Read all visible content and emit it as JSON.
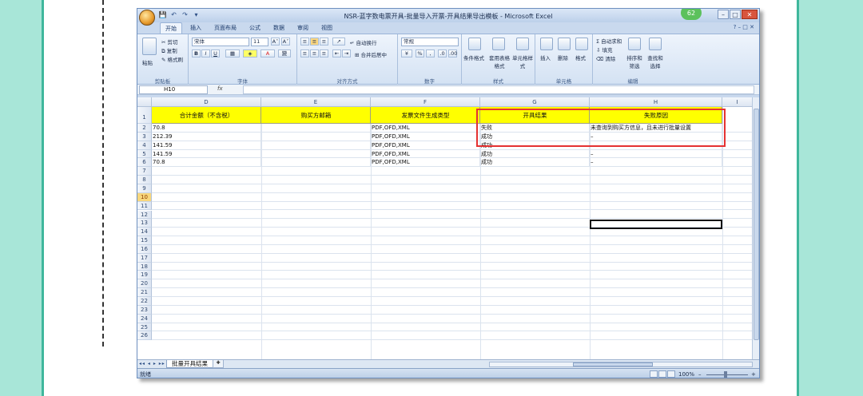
{
  "window": {
    "title": "NSR-蓝字数电票开具-批量导入开票-开具结果导出模板 - Microsoft Excel",
    "badge": "62",
    "controls": [
      "–",
      "□",
      "✕"
    ]
  },
  "qat": [
    "💾",
    "↶",
    "↷",
    "▾"
  ],
  "tabs": [
    "开始",
    "插入",
    "页面布局",
    "公式",
    "数据",
    "审阅",
    "视图"
  ],
  "active_tab": "开始",
  "ribbon": {
    "clipboard": {
      "paste": "粘贴",
      "cut": "剪切",
      "copy": "复制",
      "format_painter": "格式刷",
      "label": "剪贴板"
    },
    "font": {
      "name": "宋体",
      "size": "11",
      "bold": "B",
      "italic": "I",
      "underline": "U",
      "grow": "A˄",
      "shrink": "A˅",
      "wen": "變",
      "label": "字体"
    },
    "alignment": {
      "wrap": "自动换行",
      "merge": "合并后居中",
      "label": "对齐方式"
    },
    "number": {
      "format": "常规",
      "percent": "%",
      "comma": ",",
      "label": "数字"
    },
    "styles": {
      "conditional": "条件格式",
      "table": "套用表格格式",
      "cell": "单元格样式",
      "label": "样式"
    },
    "cells": {
      "insert": "插入",
      "delete": "删除",
      "format": "格式",
      "label": "单元格"
    },
    "editing": {
      "autosum": "Σ 自动求和",
      "fill": "填充",
      "clear": "清除",
      "sort": "排序和筛选",
      "find": "查找和选择",
      "label": "编辑"
    }
  },
  "formula_bar": {
    "name_box": "H10",
    "fx": "fx",
    "value": ""
  },
  "columns": [
    "D",
    "E",
    "F",
    "G",
    "H",
    "I"
  ],
  "header_row": [
    "合计金额（不含税）",
    "购买方邮箱",
    "发票文件生成类型",
    "开具结果",
    "失败原因",
    ""
  ],
  "rows": [
    [
      "70.8",
      "",
      "PDF,OFD,XML",
      "失败",
      "未查询到购买方信息，且未进行批量设置"
    ],
    [
      "212.39",
      "",
      "PDF,OFD,XML",
      "成功",
      "–"
    ],
    [
      "141.59",
      "",
      "PDF,OFD,XML",
      "成功",
      "–"
    ],
    [
      "141.59",
      "",
      "PDF,OFD,XML",
      "成功",
      "–"
    ],
    [
      "70.8",
      "",
      "PDF,OFD,XML",
      "成功",
      "–"
    ]
  ],
  "row_numbers": [
    "1",
    "2",
    "3",
    "4",
    "5",
    "6",
    "7",
    "8",
    "9",
    "10",
    "11",
    "12",
    "13",
    "14",
    "15",
    "16",
    "17",
    "18",
    "19",
    "20",
    "21",
    "22",
    "23",
    "24",
    "25",
    "26"
  ],
  "selected_row": "10",
  "sheet_tabs": [
    "批量开具结果"
  ],
  "status": {
    "text": "就绪",
    "zoom": "100%",
    "zoom_minus": "–",
    "zoom_plus": "+"
  },
  "colors": {
    "header_fill": "#ffff00",
    "highlight_border": "#e53232",
    "frame": "#a8e6d8"
  }
}
